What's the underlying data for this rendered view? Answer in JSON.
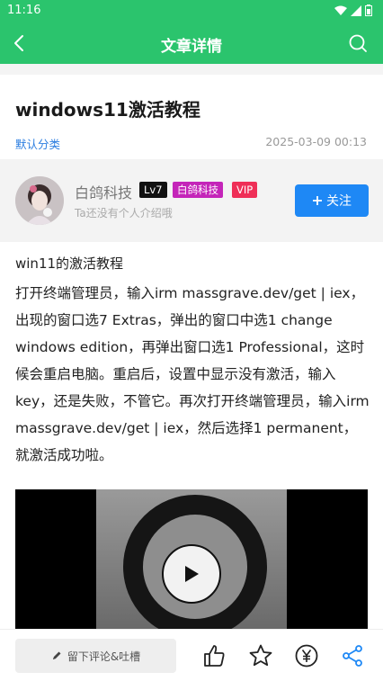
{
  "status_bar": {
    "time": "11:16",
    "icons": [
      "wifi-icon",
      "signal-icon",
      "battery-icon"
    ]
  },
  "appbar": {
    "title": "文章详情",
    "back_icon": "arrow-left-icon",
    "search_icon": "search-icon"
  },
  "article": {
    "title": "windows11激活教程",
    "category": "默认分类",
    "date": "2025-03-09 00:13"
  },
  "author": {
    "name": "白鸽科技",
    "level": "Lv7",
    "tag": "白鸽科技",
    "vip": "VIP",
    "bio": "Ta还没有个人介绍哦",
    "follow_label": "关注",
    "follow_icon": "plus-icon"
  },
  "content": {
    "heading": "win11的激活教程",
    "body": "打开终端管理员，输入irm massgrave.dev/get | iex，出现的窗口选7 Extras，弹出的窗口中选1 change windows edition，再弹出窗口选1 Professional，这时候会重启电脑。重启后，设置中显示没有激活，输入key，还是失败，不管它。再次打开终端管理员，输入irm massgrave.dev/get | iex，然后选择1 permanent，就激活成功啦。"
  },
  "bottom_bar": {
    "comment_placeholder": "留下评论&吐槽",
    "icons": [
      "pencil-icon",
      "thumbs-up-icon",
      "star-icon",
      "yen-coin-icon",
      "share-icon"
    ]
  },
  "colors": {
    "primary": "#2bc46d",
    "accent": "#1e88f5",
    "link": "#2b7de0",
    "share": "#1e88f5"
  }
}
